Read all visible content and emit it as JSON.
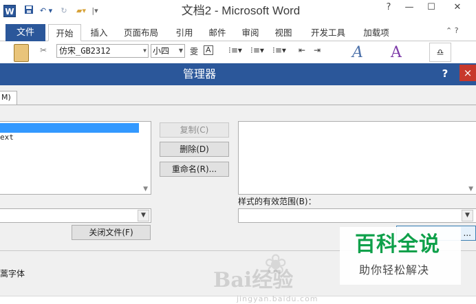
{
  "word": {
    "title": "文档2 - Microsoft Word",
    "app_icon": "W",
    "qat": [
      "save-icon",
      "undo-icon",
      "redo-icon",
      "open-icon",
      "customize-qat-icon"
    ],
    "window_controls": [
      "?",
      "—",
      "☐",
      "✕"
    ],
    "file_tab": "文件",
    "tabs": [
      "开始",
      "插入",
      "页面布局",
      "引用",
      "邮件",
      "审阅",
      "视图",
      "开发工具",
      "加载项"
    ],
    "active_tab": "开始",
    "font_name": "仿宋_GB2312",
    "font_size": "小四",
    "ribbon_glyphs": [
      "wen-icon",
      "A-box-icon",
      "bullets-icon",
      "numbering-icon",
      "multilevel-icon",
      "decrease-indent-icon",
      "increase-indent-icon"
    ]
  },
  "dialog": {
    "title": "管理器",
    "help": "?",
    "close": "×",
    "tab_macro": "M)",
    "left_list": {
      "items": [
        "",
        "ext"
      ],
      "selected_index": 0
    },
    "buttons": {
      "copy": "复制(C)",
      "delete": "删除(D)",
      "rename": "重命名(R)...",
      "close_file": "关闭文件(F)",
      "right_bottom": "..."
    },
    "scope_label": "样式的有效范围(B)：",
    "left_combo_value": "",
    "right_combo_value": "",
    "description": "蒿字体"
  },
  "watermark": {
    "baike_main": "百科全说",
    "baike_sub": "助你轻松解决",
    "baidu_text": "Bai经验",
    "jingyan_url": "jingyan.baidu.com"
  }
}
